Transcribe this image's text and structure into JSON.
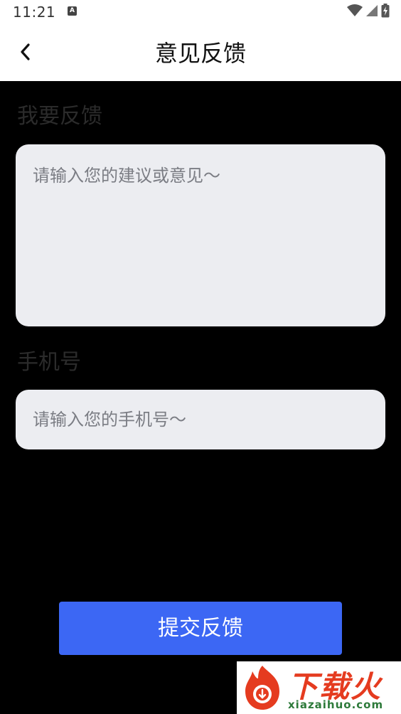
{
  "status_bar": {
    "time": "11:21",
    "icons": [
      "notification-a-icon",
      "wifi-icon",
      "signal-icon",
      "battery-charging-icon"
    ]
  },
  "header": {
    "title": "意见反馈",
    "back_icon": "chevron-left-icon"
  },
  "feedback_section": {
    "label": "我要反馈",
    "placeholder": "请输入您的建议或意见～",
    "value": ""
  },
  "phone_section": {
    "label": "手机号",
    "placeholder": "请输入您的手机号～",
    "value": ""
  },
  "submit": {
    "label": "提交反馈"
  },
  "watermark": {
    "brand": "下载火",
    "url": "xiazaihuo.com"
  },
  "colors": {
    "background": "#000000",
    "header_bg": "#ffffff",
    "input_bg": "#ecedf1",
    "placeholder": "#7b7d84",
    "section_label": "#2b2b2b",
    "primary_button": "#3c67f4",
    "watermark_red": "#e53b1f",
    "watermark_green": "#2d7a3a"
  }
}
